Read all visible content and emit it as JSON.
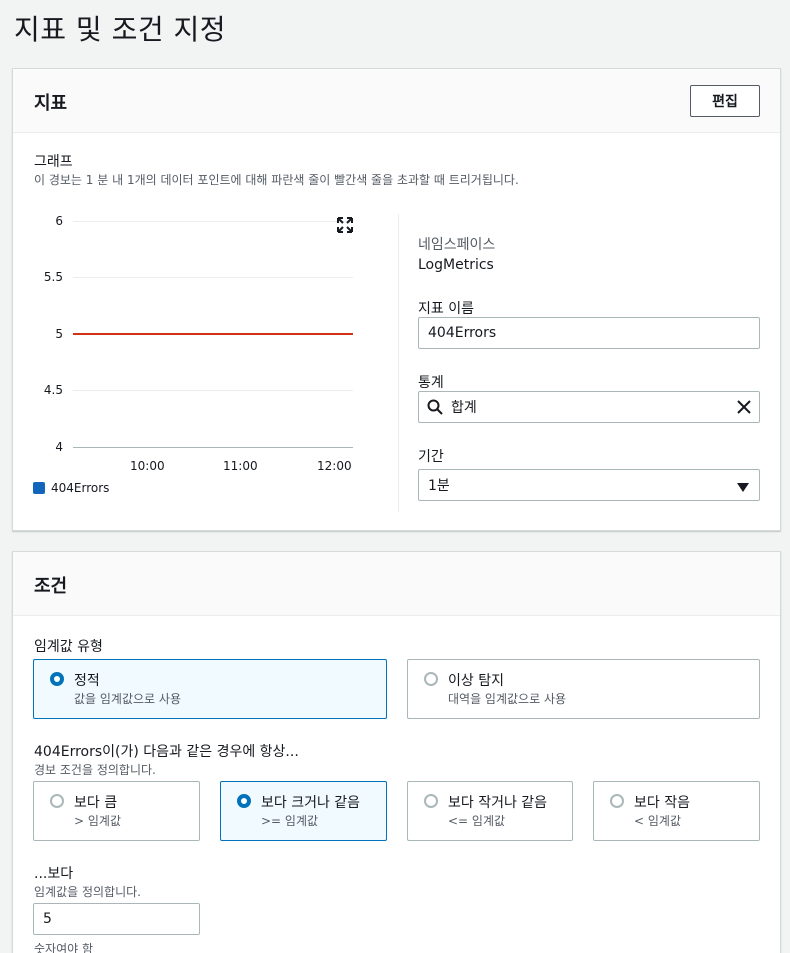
{
  "page": {
    "title": "지표 및 조건 지정"
  },
  "metric_panel": {
    "title": "지표",
    "edit_label": "편집",
    "graph_label": "그래프",
    "graph_desc": "이 경보는 1 분 내 1개의 데이터 포인트에 대해 파란색 줄이 빨간색 줄을 초과할 때 트리거됩니다.",
    "namespace_label": "네임스페이스",
    "namespace_value": "LogMetrics",
    "metric_name_label": "지표 이름",
    "metric_name_value": "404Errors",
    "statistic_label": "통계",
    "statistic_value": "합계",
    "period_label": "기간",
    "period_value": "1분"
  },
  "chart_data": {
    "type": "line",
    "x": [
      "10:00",
      "11:00",
      "12:00"
    ],
    "ylim": [
      4,
      6
    ],
    "yticks": [
      "6",
      "5.5",
      "5",
      "4.5",
      "4"
    ],
    "threshold": 5,
    "threshold_color": "#d13212",
    "series": [
      {
        "name": "404Errors",
        "values": [],
        "color": "#1166bb"
      }
    ],
    "grid": true,
    "legend": "bottom-left"
  },
  "conditions_panel": {
    "title": "조건",
    "threshold_type_label": "임계값 유형",
    "threshold_types": [
      {
        "title": "정적",
        "desc": "값을 임계값으로 사용",
        "selected": true
      },
      {
        "title": "이상 탐지",
        "desc": "대역을 임계값으로 사용",
        "selected": false
      }
    ],
    "whenever_label": "404Errors이(가) 다음과 같은 경우에 항상...",
    "whenever_desc": "경보 조건을 정의합니다.",
    "operators": [
      {
        "title": "보다 큼",
        "desc": "> 임계값",
        "selected": false
      },
      {
        "title": "보다 크거나 같음",
        "desc": ">= 임계값",
        "selected": true
      },
      {
        "title": "보다 작거나 같음",
        "desc": "<= 임계값",
        "selected": false
      },
      {
        "title": "보다 작음",
        "desc": "< 임계값",
        "selected": false
      }
    ],
    "than_label": "...보다",
    "than_desc": "임계값을 정의합니다.",
    "threshold_value": "5",
    "threshold_hint": "숫자여야 함"
  },
  "colors": {
    "accent": "#0073bb",
    "threshold_line": "#d13212",
    "series": "#1166bb"
  }
}
